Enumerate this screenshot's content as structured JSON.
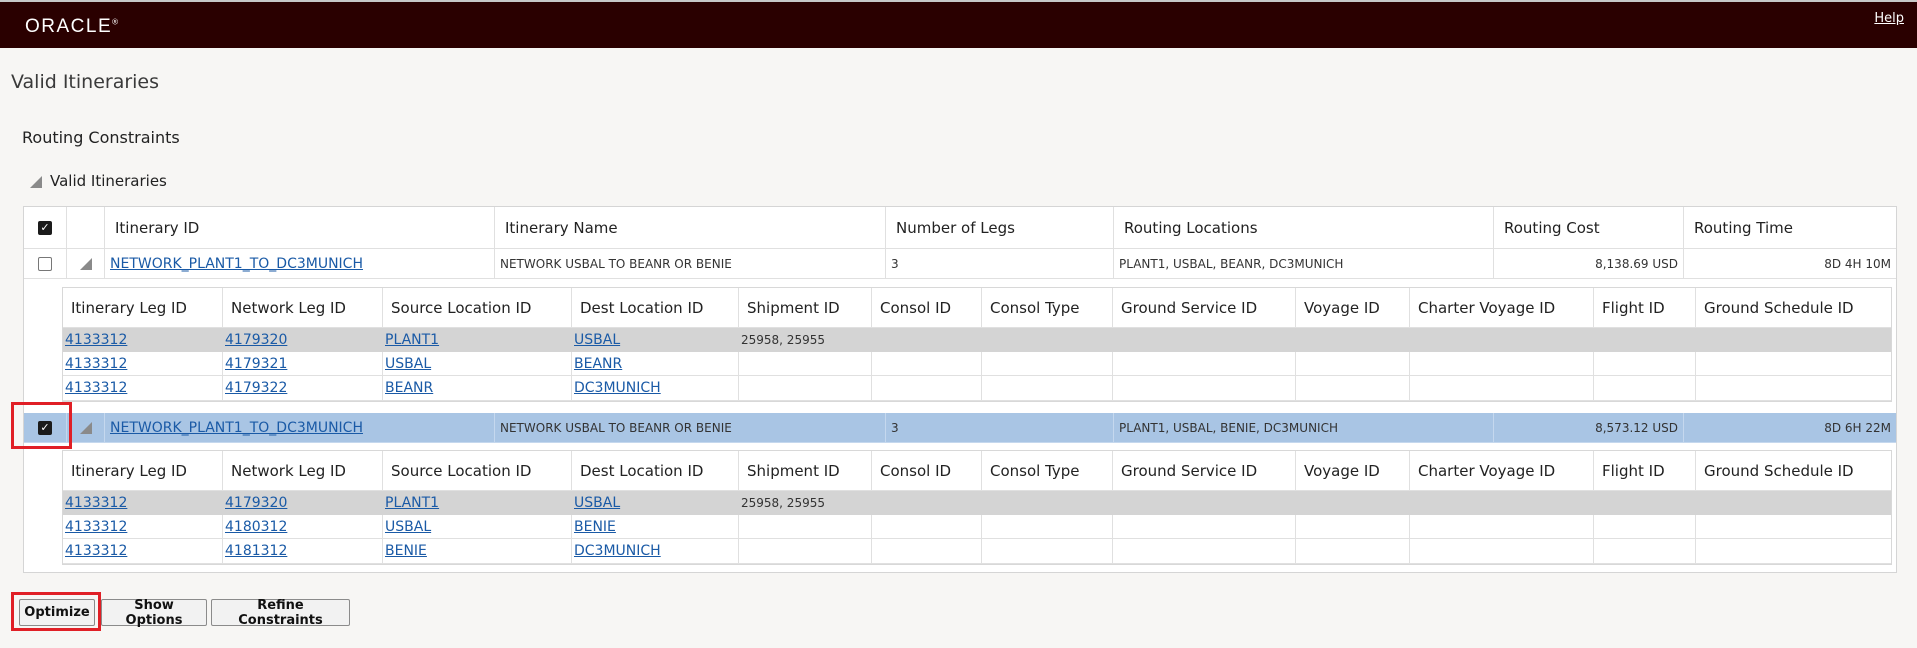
{
  "header": {
    "logo": "ORACLE",
    "logo_mark": "®",
    "help": "Help"
  },
  "page_title": "Valid Itineraries",
  "section_title": "Routing Constraints",
  "subsection_title": "Valid Itineraries",
  "table": {
    "columns": [
      "Itinerary ID",
      "Itinerary Name",
      "Number of Legs",
      "Routing Locations",
      "Routing Cost",
      "Routing Time"
    ],
    "rows": [
      {
        "checked": false,
        "id": "NETWORK_PLANT1_TO_DC3MUNICH",
        "name": "NETWORK USBAL TO BEANR OR BENIE",
        "legs": "3",
        "locations": "PLANT1, USBAL, BEANR, DC3MUNICH",
        "cost": "8,138.69 USD",
        "time": "8D 4H 10M"
      },
      {
        "checked": true,
        "id": "NETWORK_PLANT1_TO_DC3MUNICH",
        "name": "NETWORK USBAL TO BEANR OR BENIE",
        "legs": "3",
        "locations": "PLANT1, USBAL, BENIE, DC3MUNICH",
        "cost": "8,573.12 USD",
        "time": "8D 6H 22M"
      }
    ]
  },
  "leg_columns": [
    "Itinerary Leg ID",
    "Network Leg ID",
    "Source Location ID",
    "Dest Location ID",
    "Shipment ID",
    "Consol ID",
    "Consol Type",
    "Ground Service ID",
    "Voyage ID",
    "Charter Voyage ID",
    "Flight ID",
    "Ground Schedule ID"
  ],
  "legs_1": [
    {
      "itin_leg": "4133312",
      "net_leg": "4179320",
      "source": "PLANT1",
      "dest": "USBAL",
      "shipment": "25958, 25955"
    },
    {
      "itin_leg": "4133312",
      "net_leg": "4179321",
      "source": "USBAL",
      "dest": "BEANR",
      "shipment": ""
    },
    {
      "itin_leg": "4133312",
      "net_leg": "4179322",
      "source": "BEANR",
      "dest": "DC3MUNICH",
      "shipment": ""
    }
  ],
  "legs_2": [
    {
      "itin_leg": "4133312",
      "net_leg": "4179320",
      "source": "PLANT1",
      "dest": "USBAL",
      "shipment": "25958, 25955"
    },
    {
      "itin_leg": "4133312",
      "net_leg": "4180312",
      "source": "USBAL",
      "dest": "BENIE",
      "shipment": ""
    },
    {
      "itin_leg": "4133312",
      "net_leg": "4181312",
      "source": "BENIE",
      "dest": "DC3MUNICH",
      "shipment": ""
    }
  ],
  "buttons": {
    "optimize": "Optimize",
    "show_options": "Show Options",
    "refine": "Refine Constraints"
  },
  "colors": {
    "header_bg": "#2a0000",
    "selected_row": "#a9c5e4",
    "highlight_box": "#e01f26",
    "link": "#1a5aa6"
  }
}
